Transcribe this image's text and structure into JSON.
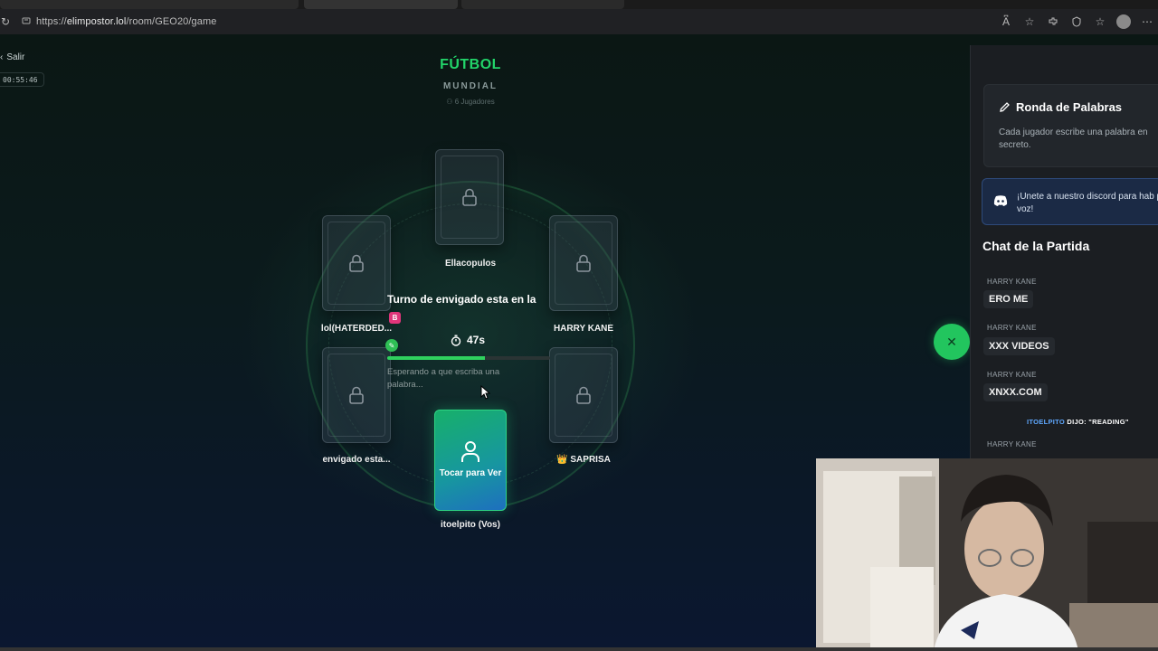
{
  "browser": {
    "url_prefix": "https://",
    "url_host": "elimpostor.lol",
    "url_path": "/room/GEO20/game",
    "icons": [
      "read-aloud-icon",
      "favorite-star-icon",
      "extensions-icon",
      "browser-essentials-icon",
      "favorites-icon",
      "profile-icon",
      "more-icon"
    ]
  },
  "header": {
    "exit_label": "Salir",
    "elapsed": "00:55:46",
    "category": "FÚTBOL",
    "subcategory": "MUNDIAL",
    "players_count": "6 Jugadores"
  },
  "players": {
    "top": "Ellacopulos",
    "upper_left": "lol(HATERDED...",
    "upper_right": "HARRY KANE",
    "lower_left": "envigado esta...",
    "lower_right_crown": "👑",
    "lower_right": "SAPRISA",
    "me": "itoelpito (Vos)"
  },
  "me_card": {
    "label": "Tocar para Ver"
  },
  "turn": {
    "text": "Turno de envigado esta en la",
    "badge": "B",
    "seconds": "47s",
    "progress": 0.6,
    "waiting": "Esperando a que escriba una palabra..."
  },
  "sidebar": {
    "round_title": "Ronda de Palabras",
    "round_desc": "Cada jugador escribe una palabra en secreto.",
    "discord_text": "¡Unete a nuestro discord para hab por voz!",
    "chat_title": "Chat de la Partida",
    "messages": [
      {
        "author": "HARRY KANE",
        "text": "ERO ME"
      },
      {
        "author": "HARRY KANE",
        "text": "XXX VIDEOS"
      },
      {
        "author": "HARRY KANE",
        "text": "XNXX.COM"
      }
    ],
    "system_msg_who": "ITOELPITO",
    "system_msg_rest": " DIJO: ",
    "system_msg_word": "\"READING\"",
    "last_author": "HARRY KANE"
  },
  "colors": {
    "accent_green": "#22d46a",
    "badge_pink": "#e0357a",
    "discord_blue": "#1b2a45"
  }
}
